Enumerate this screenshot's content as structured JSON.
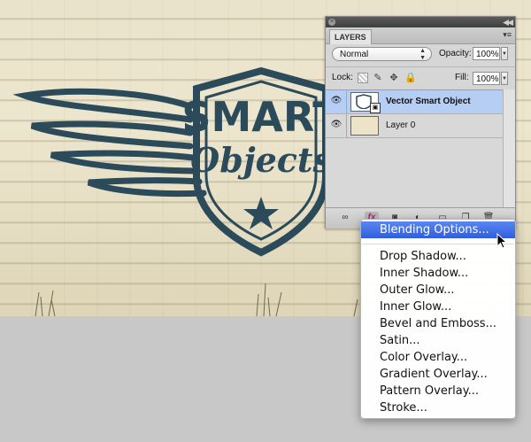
{
  "panel": {
    "tab_label": "LAYERS",
    "blend_mode": "Normal",
    "opacity_label": "Opacity:",
    "opacity_value": "100%",
    "lock_label": "Lock:",
    "fill_label": "Fill:",
    "fill_value": "100%",
    "layers": [
      {
        "name": "Vector Smart Object",
        "selected": true
      },
      {
        "name": "Layer 0",
        "selected": false
      }
    ]
  },
  "context_menu": {
    "items": [
      "Blending Options...",
      "Drop Shadow...",
      "Inner Shadow...",
      "Outer Glow...",
      "Inner Glow...",
      "Bevel and Emboss...",
      "Satin...",
      "Color Overlay...",
      "Gradient Overlay...",
      "Pattern Overlay...",
      "Stroke..."
    ],
    "highlighted": "Blending Options..."
  },
  "artwork": {
    "line1": "SMART",
    "line2": "Objects",
    "ink_color": "#2b4a5a"
  },
  "colors": {
    "highlight": "#3b6be6",
    "selected_layer": "#b6cdf4"
  }
}
